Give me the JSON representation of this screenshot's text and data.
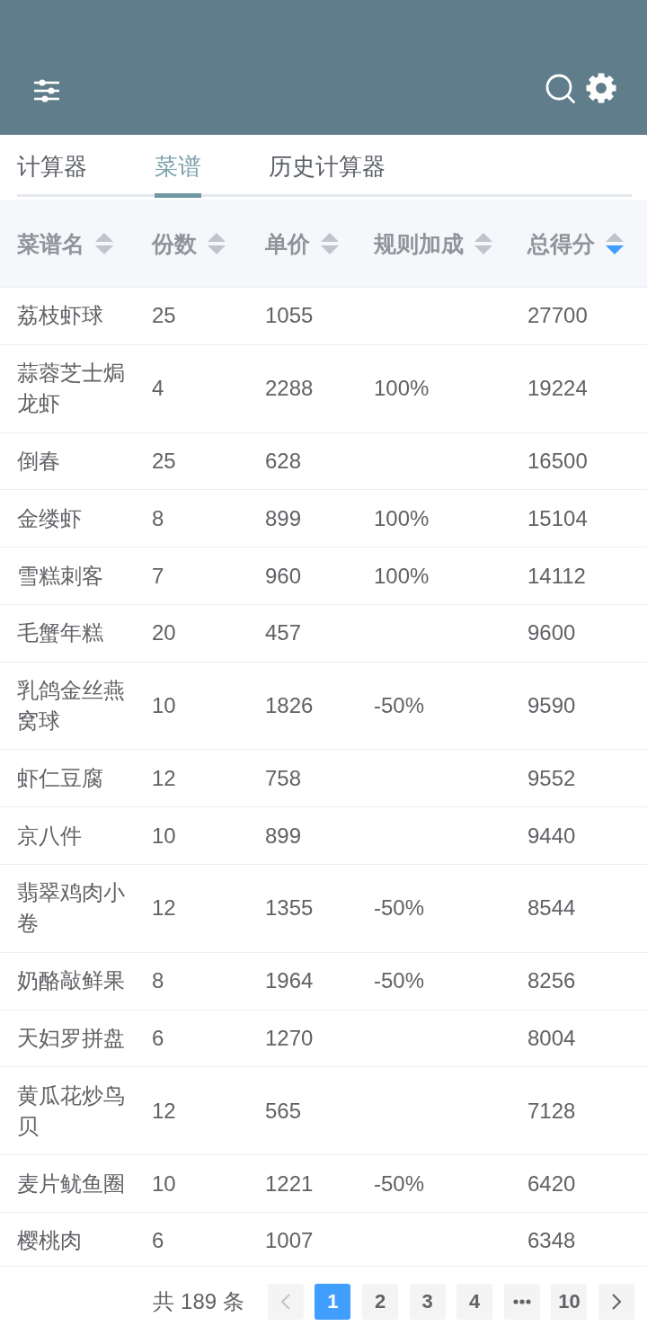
{
  "tabs": [
    {
      "label": "计算器",
      "selected": false
    },
    {
      "label": "菜谱",
      "selected": true
    },
    {
      "label": "历史计算器",
      "selected": false
    }
  ],
  "table": {
    "columns": [
      {
        "label": "菜谱名",
        "sorted_descending": false
      },
      {
        "label": "份数",
        "sorted_descending": false
      },
      {
        "label": "单价",
        "sorted_descending": false
      },
      {
        "label": "规则加成",
        "sorted_descending": false
      },
      {
        "label": "总得分",
        "sorted_descending": true
      }
    ],
    "rows": [
      {
        "name": "荔枝虾球",
        "portions": "25",
        "unit_price": "1055",
        "total_score": "27700"
      },
      {
        "name": "蒜蓉芝士焗龙虾",
        "portions": "4",
        "unit_price": "2288",
        "rule_bonus": "100%",
        "total_score": "19224"
      },
      {
        "name": "倒春",
        "portions": "25",
        "unit_price": "628",
        "total_score": "16500"
      },
      {
        "name": "金缕虾",
        "portions": "8",
        "unit_price": "899",
        "rule_bonus": "100%",
        "total_score": "15104"
      },
      {
        "name": "雪糕刺客",
        "portions": "7",
        "unit_price": "960",
        "rule_bonus": "100%",
        "total_score": "14112"
      },
      {
        "name": "毛蟹年糕",
        "portions": "20",
        "unit_price": "457",
        "total_score": "9600"
      },
      {
        "name": "乳鸽金丝燕窝球",
        "portions": "10",
        "unit_price": "1826",
        "rule_bonus": "-50%",
        "total_score": "9590"
      },
      {
        "name": "虾仁豆腐",
        "portions": "12",
        "unit_price": "758",
        "total_score": "9552"
      },
      {
        "name": "京八件",
        "portions": "10",
        "unit_price": "899",
        "total_score": "9440"
      },
      {
        "name": "翡翠鸡肉小卷",
        "portions": "12",
        "unit_price": "1355",
        "rule_bonus": "-50%",
        "total_score": "8544"
      },
      {
        "name": "奶酪敲鲜果",
        "portions": "8",
        "unit_price": "1964",
        "rule_bonus": "-50%",
        "total_score": "8256"
      },
      {
        "name": "天妇罗拼盘",
        "portions": "6",
        "unit_price": "1270",
        "total_score": "8004"
      },
      {
        "name": "黄瓜花炒鸟贝",
        "portions": "12",
        "unit_price": "565",
        "total_score": "7128"
      },
      {
        "name": "麦片鱿鱼圈",
        "portions": "10",
        "unit_price": "1221",
        "rule_bonus": "-50%",
        "total_score": "6420"
      },
      {
        "name": "樱桃肉",
        "portions": "6",
        "unit_price": "1007",
        "total_score": "6348"
      }
    ]
  },
  "pagination": {
    "total": "共 189 条",
    "prev": {
      "disabled": true
    },
    "pages": [
      {
        "kind": "page",
        "label": "1",
        "selected": true
      },
      {
        "kind": "page",
        "label": "2",
        "selected": false
      },
      {
        "kind": "page",
        "label": "3",
        "selected": false
      },
      {
        "kind": "page",
        "label": "4",
        "selected": false
      },
      {
        "kind": "more",
        "selected": false
      },
      {
        "kind": "page",
        "label": "10",
        "selected": false
      }
    ],
    "next": {
      "disabled": false
    }
  }
}
